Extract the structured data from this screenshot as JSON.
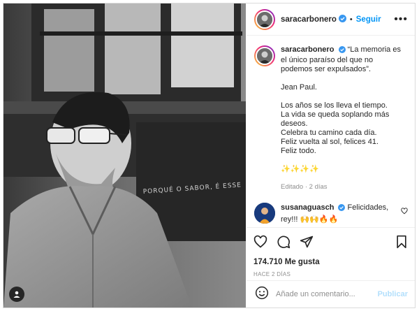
{
  "post": {
    "author": "saracarbonero",
    "follow_label": "Seguir",
    "separator": "•",
    "more_label": "•••"
  },
  "caption": {
    "author": "saracarbonero",
    "line1": "“La memoria es el único paraíso del que no podemos ser expulsados”.",
    "line2": "Jean Paul.",
    "line3": "Los años se los lleva el tiempo.\nLa vida se queda soplando más deseos.\nCelebra tu camino cada día.\nFeliz vuelta al sol, felices 41.\nFeliz todo.",
    "sparkles": "✨✨✨✨",
    "meta": "Editado · 2 días"
  },
  "comment": {
    "author": "susanaguasch",
    "text": "Felicidades, rey!!! 🙌🙌🔥🔥"
  },
  "stats": {
    "likes": "174.710 Me gusta",
    "time": "HACE 2 DÍAS"
  },
  "composer": {
    "placeholder": "Añade un comentario...",
    "publish_label": "Publicar"
  },
  "icons": [
    "tag-icon",
    "verified-icon",
    "more-icon",
    "heart-icon",
    "comment-icon",
    "share-icon",
    "save-icon",
    "emoji-icon"
  ],
  "colors": {
    "link": "#0095f6",
    "publish_disabled": "#b2dffc",
    "muted": "#8e8e8e",
    "verified": "#3897f0"
  }
}
